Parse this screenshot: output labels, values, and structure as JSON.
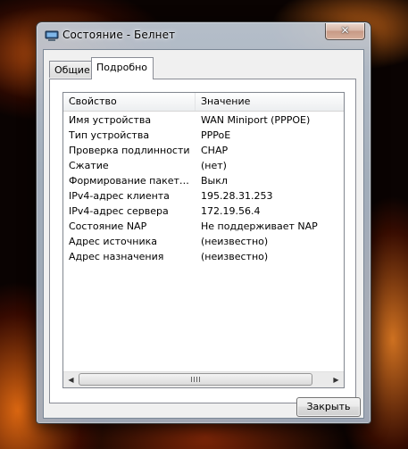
{
  "window": {
    "title": "Состояние - Белнет",
    "close_glyph": "✕"
  },
  "tabs": [
    {
      "label": "Общие",
      "selected": false
    },
    {
      "label": "Подробно",
      "selected": true
    }
  ],
  "table": {
    "headers": [
      "Свойство",
      "Значение"
    ],
    "rows": [
      {
        "property": "Имя устройства",
        "value": "WAN Miniport (PPPOE)"
      },
      {
        "property": "Тип устройства",
        "value": "PPPoE"
      },
      {
        "property": "Проверка подлинности",
        "value": "CHAP"
      },
      {
        "property": "Сжатие",
        "value": "(нет)"
      },
      {
        "property": "Формирование пакетов м...",
        "value": "Выкл"
      },
      {
        "property": "IPv4-адрес клиента",
        "value": "195.28.31.253"
      },
      {
        "property": "IPv4-адрес сервера",
        "value": "172.19.56.4"
      },
      {
        "property": "Состояние NAP",
        "value": "Не поддерживает NAP"
      },
      {
        "property": "Адрес источника",
        "value": "(неизвестно)"
      },
      {
        "property": "Адрес назначения",
        "value": "(неизвестно)"
      }
    ]
  },
  "scrollbar": {
    "left_arrow": "◀",
    "right_arrow": "▶"
  },
  "buttons": {
    "close_label": "Закрыть"
  },
  "icons": {
    "title_icon": "network-connection-icon"
  }
}
